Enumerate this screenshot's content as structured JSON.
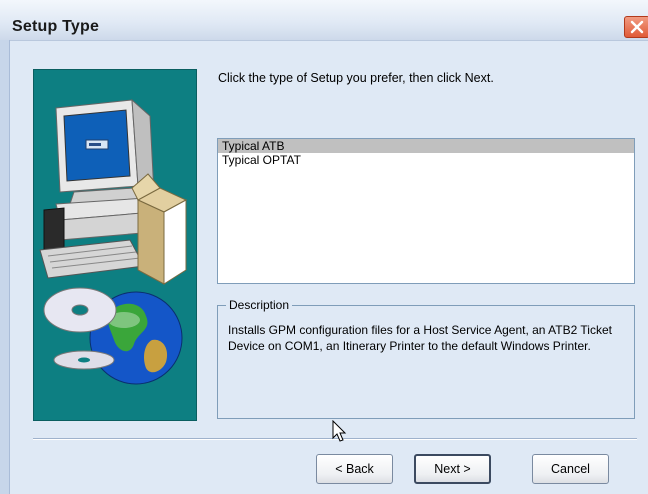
{
  "window": {
    "title": "Setup Type"
  },
  "instruction": "Click the type of Setup you prefer, then click Next.",
  "setup_options": [
    {
      "label": "Typical ATB",
      "selected": true
    },
    {
      "label": "Typical OPTAT",
      "selected": false
    }
  ],
  "description": {
    "legend": "Description",
    "text": "Installs GPM configuration files for a Host Service Agent, an ATB2 Ticket Device on COM1, an Itinerary Printer to the default Windows Printer."
  },
  "buttons": {
    "back": "< Back",
    "next": "Next >",
    "cancel": "Cancel"
  },
  "colors": {
    "art_background": "#0d7f82",
    "selection": "#c0c0c0",
    "dialog_bg": "#dfe9f5"
  }
}
